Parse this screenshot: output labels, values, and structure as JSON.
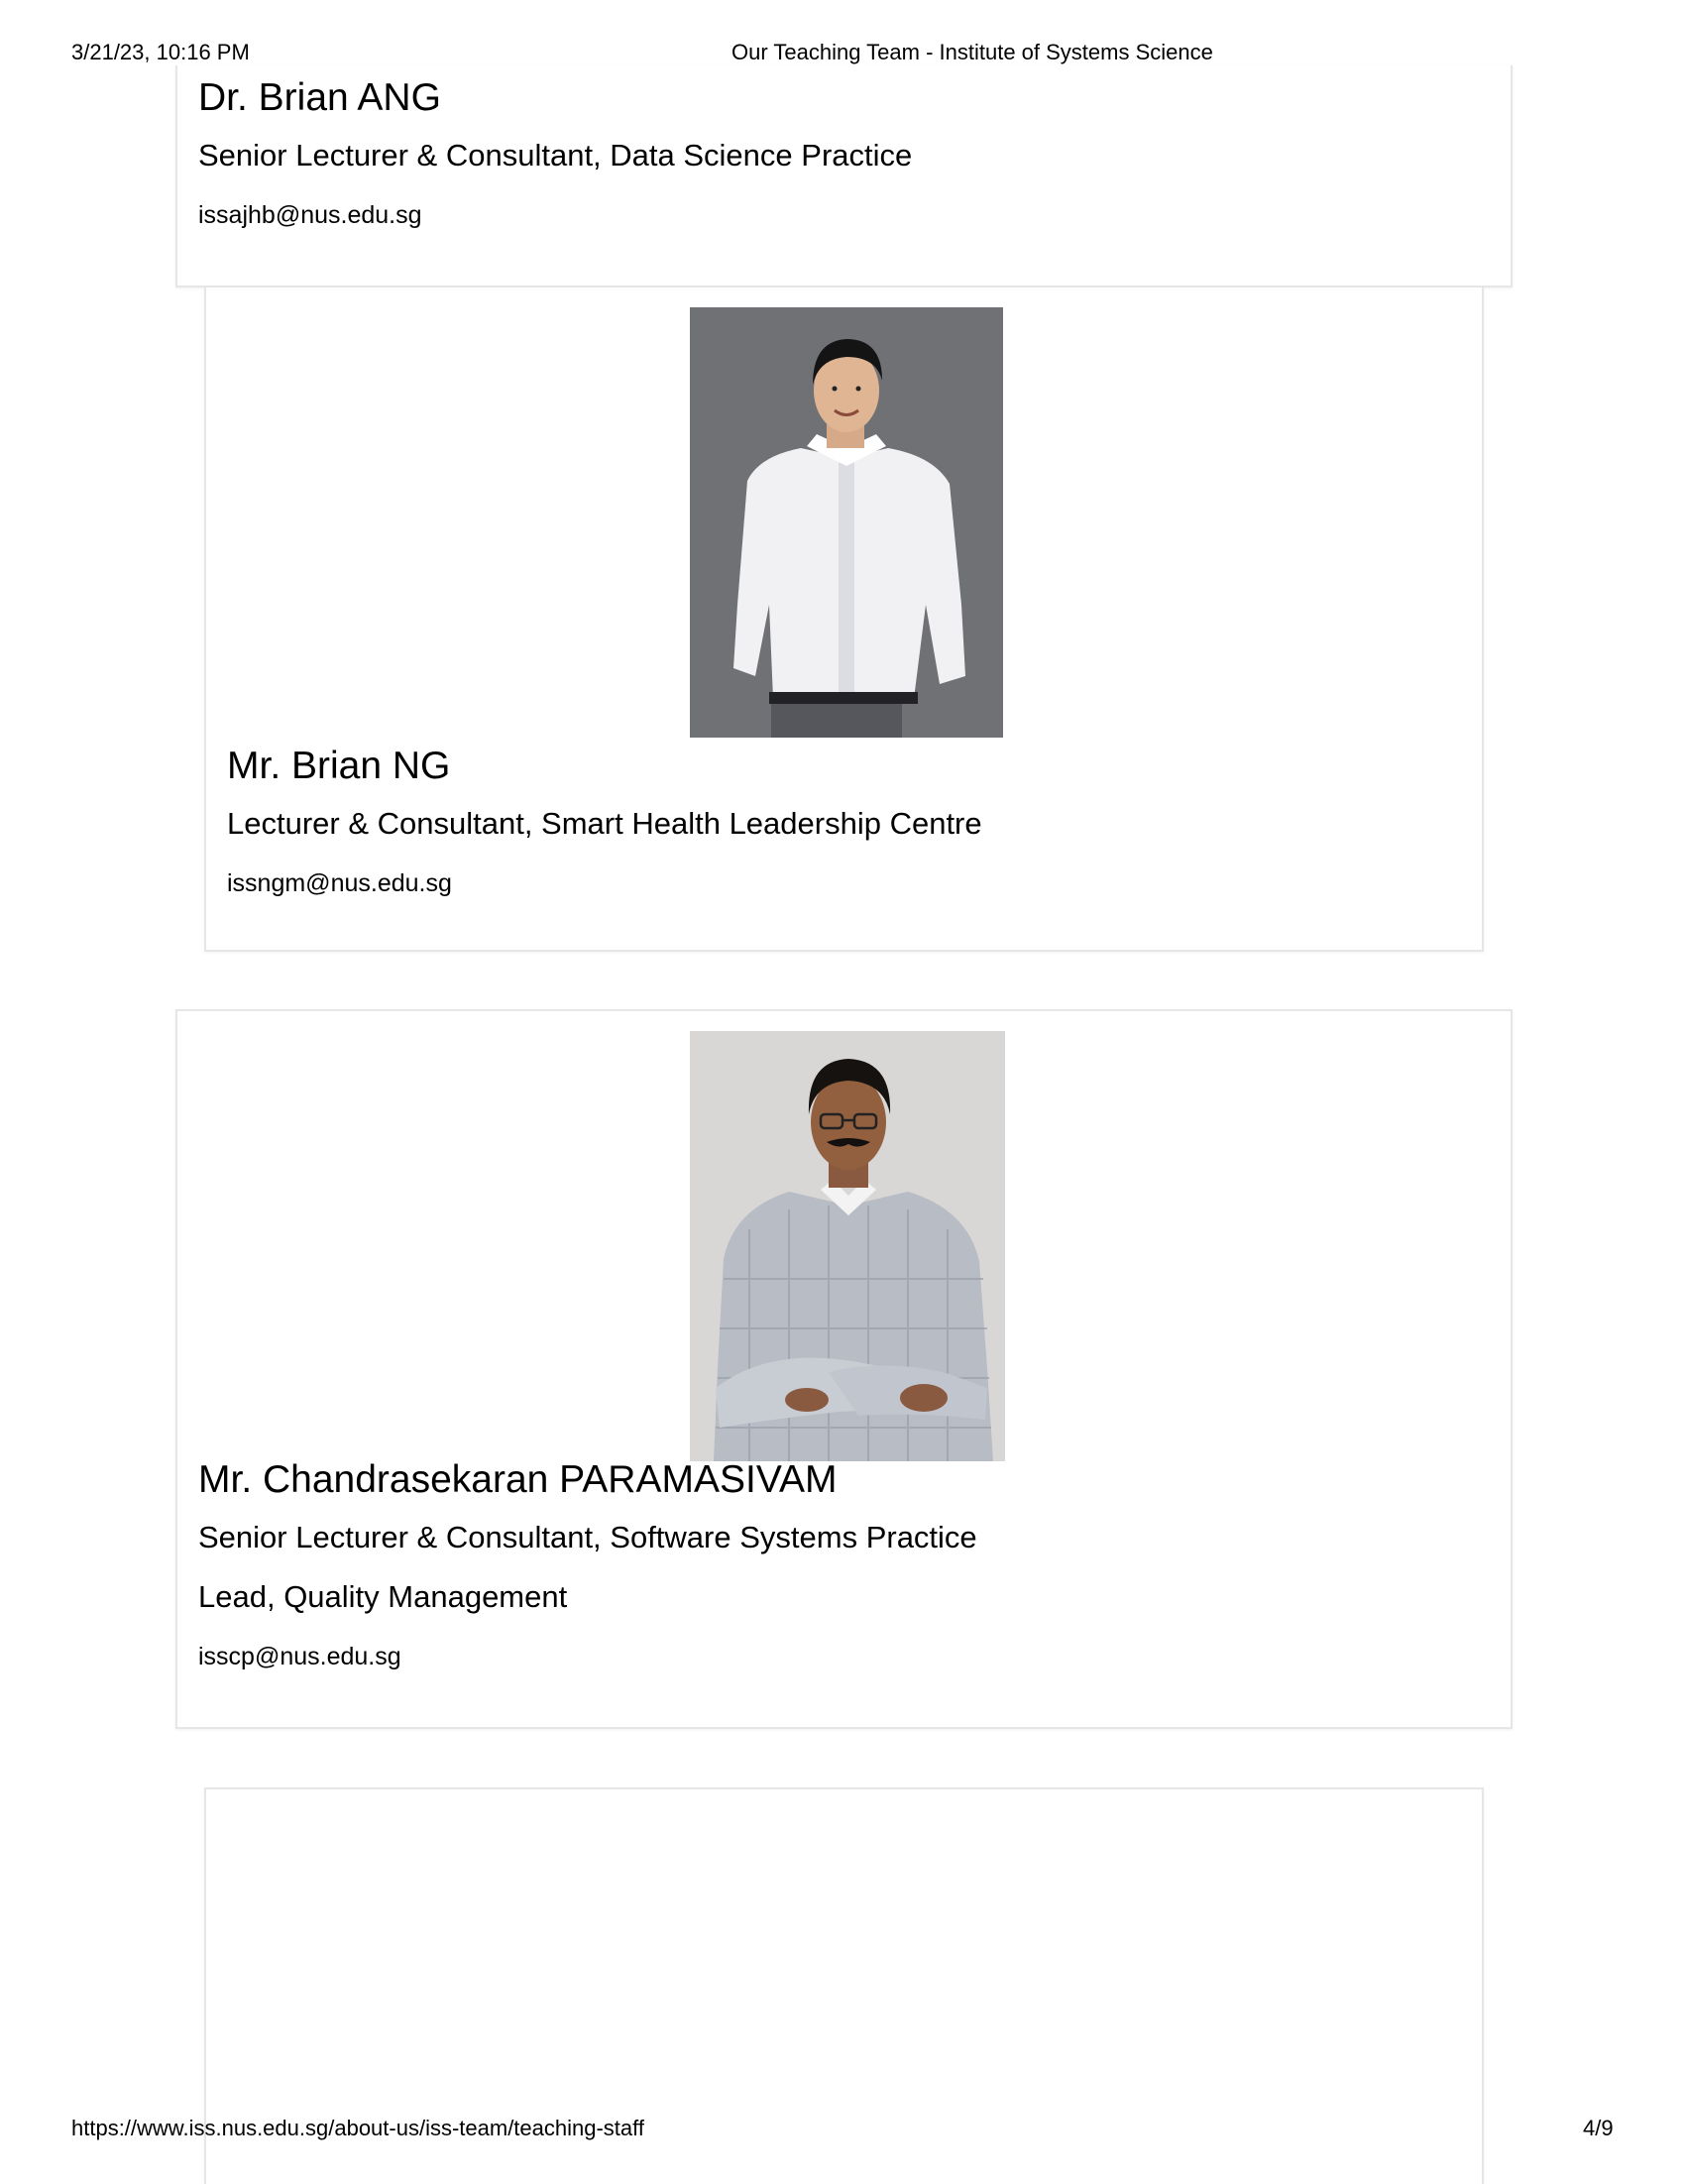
{
  "print_header": {
    "datetime": "3/21/23, 10:16 PM",
    "page_title": "Our Teaching Team - Institute of Systems Science"
  },
  "staff": [
    {
      "name": "Dr. Brian ANG",
      "roles": [
        "Senior Lecturer & Consultant, Data Science Practice"
      ],
      "email": "issajhb@nus.edu.sg"
    },
    {
      "name": "Mr. Brian NG",
      "roles": [
        "Lecturer & Consultant, Smart Health Leadership Centre"
      ],
      "email": "issngm@nus.edu.sg"
    },
    {
      "name": "Mr. Chandrasekaran PARAMASIVAM",
      "roles": [
        "Senior Lecturer & Consultant, Software Systems Practice",
        "Lead, Quality Management"
      ],
      "email": "isscp@nus.edu.sg"
    }
  ],
  "print_footer": {
    "url": "https://www.iss.nus.edu.sg/about-us/iss-team/teaching-staff",
    "page_number": "4/9"
  },
  "colors": {
    "card_border": "#e6e6e6",
    "photo_bg_grey": "#6f7175",
    "photo_bg_light": "#d9d7d6"
  }
}
